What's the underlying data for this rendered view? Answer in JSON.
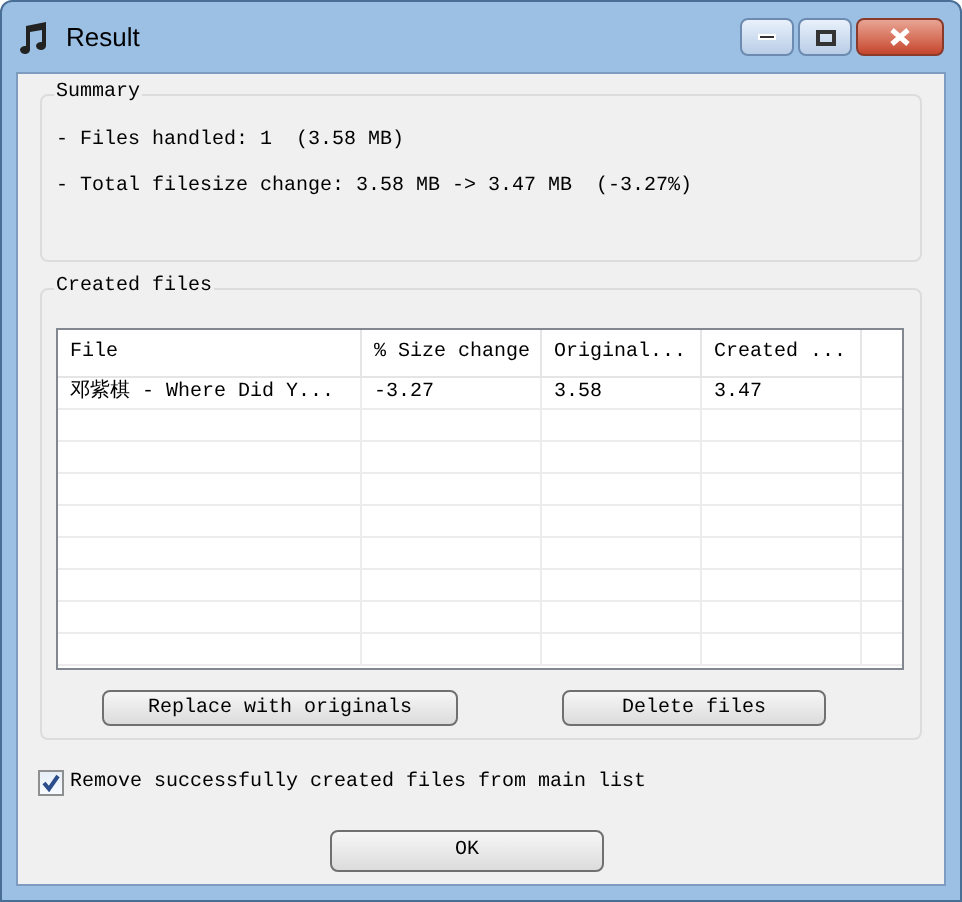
{
  "window": {
    "title": "Result"
  },
  "summary": {
    "title": "Summary",
    "lines": [
      "- Files handled: 1  (3.58 MB)",
      "- Total filesize change: 3.58 MB -> 3.47 MB  (-3.27%)"
    ]
  },
  "created_files": {
    "title": "Created files",
    "table": {
      "columns": [
        "File",
        "% Size change",
        "Original...",
        "Created ..."
      ],
      "rows": [
        [
          "邓紫棋 - Where Did Y...",
          "-3.27",
          "3.58",
          "3.47"
        ]
      ]
    },
    "buttons": [
      "Replace with originals",
      "Delete files"
    ]
  },
  "option": {
    "label": "Remove successfully created files from main list",
    "checked": true
  },
  "ok_button": "OK"
}
